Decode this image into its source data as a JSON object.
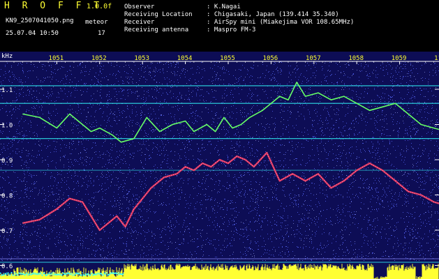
{
  "header": {
    "app_title": "H R O F F T",
    "version": "1.0.0f",
    "filename": "KN9_2507041050.png",
    "datetime": "25.07.04 10:50",
    "meteor_label": "meteor",
    "meteor_count": "17",
    "info": [
      {
        "label": "Observer",
        "value": ": K.Nagai"
      },
      {
        "label": "Receiving Location",
        "value": ": Chigasaki, Japan (139.414 35.340)"
      },
      {
        "label": "Receiver",
        "value": ": AirSpy mini (Miakejima VOR 108.65MHz)"
      },
      {
        "label": "Receiving antenna",
        "value": ": Maspro FM-3"
      }
    ]
  },
  "colors": {
    "background": "#0d0d55",
    "noise": "#5a6aff",
    "header_yellow": "#ffff33",
    "cyan": "#33ffff",
    "green": "#66ff66",
    "red": "#ff3355"
  },
  "chart_data": {
    "type": "heatmap",
    "ylabel": "kHz",
    "x_ticks": [
      "1051",
      "1052",
      "1053",
      "1054",
      "1055",
      "1056",
      "1057",
      "1058",
      "1059",
      "1100"
    ],
    "y_ticks": [
      "1.1",
      "1.0",
      "0.9",
      "0.8",
      "0.7",
      "0.6"
    ],
    "ylim": [
      0.6,
      1.15
    ],
    "horizontal_lines_khz": [
      1.11,
      1.06,
      0.96,
      0.87
    ],
    "green_trace": {
      "x": [
        1050.2,
        1050.6,
        1051.0,
        1051.3,
        1051.6,
        1051.8,
        1052.0,
        1052.3,
        1052.5,
        1052.8,
        1053.1,
        1053.4,
        1053.7,
        1054.0,
        1054.2,
        1054.5,
        1054.7,
        1054.9,
        1055.1,
        1055.3,
        1055.5,
        1055.8,
        1056.0,
        1056.2,
        1056.4,
        1056.6,
        1056.8,
        1057.1,
        1057.4,
        1057.7,
        1058.0,
        1058.3,
        1058.6,
        1058.9,
        1059.2,
        1059.5,
        1059.8,
        1100.1,
        1100.4
      ],
      "y": [
        1.03,
        1.02,
        0.99,
        1.03,
        1.0,
        0.98,
        0.99,
        0.97,
        0.95,
        0.96,
        1.02,
        0.98,
        1.0,
        1.01,
        0.98,
        1.0,
        0.98,
        1.02,
        0.99,
        1.0,
        1.02,
        1.04,
        1.06,
        1.08,
        1.07,
        1.12,
        1.08,
        1.09,
        1.07,
        1.08,
        1.06,
        1.04,
        1.05,
        1.06,
        1.03,
        1.0,
        0.99,
        0.98,
        0.97
      ]
    },
    "red_trace": {
      "x": [
        1050.2,
        1050.6,
        1051.0,
        1051.3,
        1051.6,
        1051.8,
        1052.0,
        1052.2,
        1052.4,
        1052.6,
        1052.8,
        1053.0,
        1053.2,
        1053.5,
        1053.8,
        1054.0,
        1054.2,
        1054.4,
        1054.6,
        1054.8,
        1055.0,
        1055.2,
        1055.4,
        1055.6,
        1055.9,
        1056.2,
        1056.5,
        1056.8,
        1057.1,
        1057.4,
        1057.7,
        1058.0,
        1058.3,
        1058.6,
        1058.9,
        1059.2,
        1059.5,
        1059.8,
        1100.1,
        1100.4
      ],
      "y": [
        0.72,
        0.73,
        0.76,
        0.79,
        0.78,
        0.74,
        0.7,
        0.72,
        0.74,
        0.71,
        0.76,
        0.79,
        0.82,
        0.85,
        0.86,
        0.88,
        0.87,
        0.89,
        0.88,
        0.9,
        0.89,
        0.91,
        0.9,
        0.88,
        0.92,
        0.84,
        0.86,
        0.84,
        0.86,
        0.82,
        0.84,
        0.87,
        0.89,
        0.87,
        0.84,
        0.81,
        0.8,
        0.78,
        0.77,
        0.82
      ]
    }
  }
}
